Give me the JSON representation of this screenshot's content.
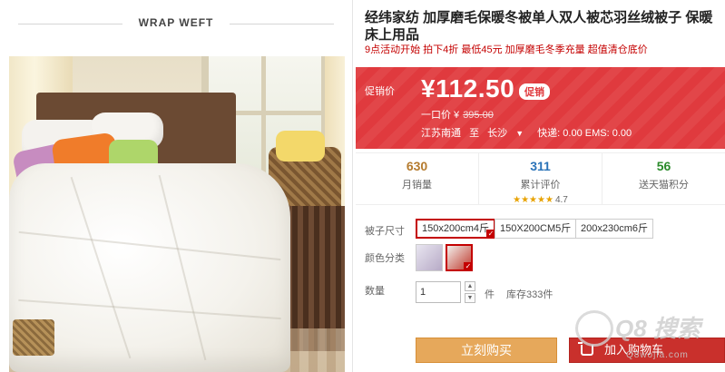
{
  "brand": {
    "text": "WRAP WEFT"
  },
  "product": {
    "title": "经纬家纺 加厚磨毛保暖冬被单人双人被芯羽丝绒被子 保暖床上用品",
    "subtitle": "9点活动开始 拍下4折 最低45元 加厚磨毛冬季充量 超值清仓底价"
  },
  "promo": {
    "label": "促销价",
    "price": "¥112.50",
    "tag": "促销",
    "original_label": "一口价 ¥",
    "original_price": "395.00",
    "from": "江苏南通",
    "to_label": "至",
    "to": "长沙",
    "shipping": "快递: 0.00 EMS: 0.00"
  },
  "stats": [
    {
      "value": "630",
      "label": "月销量",
      "color": "#b57b2e"
    },
    {
      "value": "311",
      "label": "累计评价",
      "color": "#2a73b8",
      "stars": "★★★★★",
      "rating": "4.7"
    },
    {
      "value": "56",
      "label": "送天猫积分",
      "color": "#2a8a2a"
    }
  ],
  "options": {
    "size_label": "被子尺寸",
    "sizes": [
      "150x200cm4斤",
      "150X200CM5斤",
      "200x230cm6斤"
    ],
    "selected_size": 0,
    "color_label": "颜色分类",
    "quantity_label": "数量",
    "quantity": "1",
    "unit": "件",
    "stock": "库存333件"
  },
  "actions": {
    "buy_now": "立刻购买",
    "add_to_cart": "加入购物车"
  },
  "watermark": {
    "text": "Q8 搜索",
    "sub": "Q8wojia.com"
  },
  "colors": {
    "accent": "#e03a3e",
    "buy": "#e6a85b",
    "cart": "#c9302c"
  }
}
